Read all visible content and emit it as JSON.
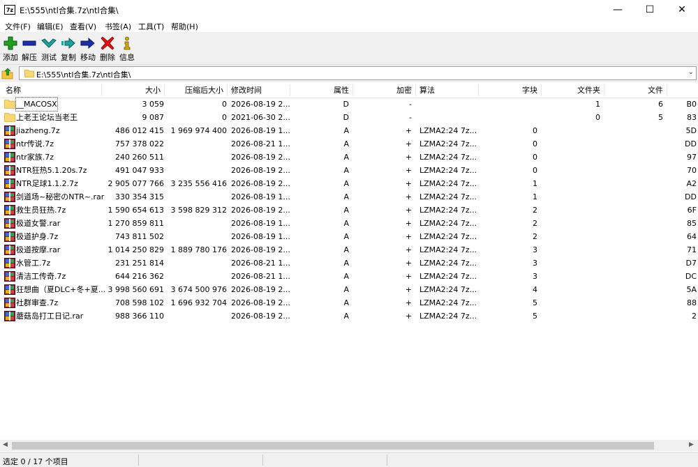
{
  "window": {
    "title": "E:\\555\\ntl合集.7z\\ntl合集\\",
    "app_icon_text": "7z",
    "controls": {
      "minimize": "—",
      "maximize": "☐",
      "close": "✕"
    }
  },
  "menu": [
    "文件(F)",
    "编辑(E)",
    "查看(V)",
    "书签(A)",
    "工具(T)",
    "帮助(H)"
  ],
  "toolbar": [
    {
      "label": "添加",
      "icon": "add-icon",
      "color": "#1fa01f"
    },
    {
      "label": "解压",
      "icon": "extract-icon",
      "color": "#1c2fa8"
    },
    {
      "label": "测试",
      "icon": "test-icon",
      "color": "#1aa3a3"
    },
    {
      "label": "复制",
      "icon": "copy-icon",
      "color": "#1aa3a3"
    },
    {
      "label": "移动",
      "icon": "move-icon",
      "color": "#1c2fa8"
    },
    {
      "label": "删除",
      "icon": "delete-icon",
      "color": "#e01010"
    },
    {
      "label": "信息",
      "icon": "info-icon",
      "color": "#d4a800"
    }
  ],
  "address": {
    "path": "E:\\555\\ntl合集.7z\\ntl合集\\"
  },
  "columns": [
    "名称",
    "大小",
    "压缩后大小",
    "修改时间",
    "属性",
    "加密",
    "算法",
    "字块",
    "文件夹",
    "文件",
    ""
  ],
  "files": [
    {
      "type": "folder",
      "name": "__MACOSX",
      "size": "3 059",
      "packed": "0",
      "modified": "2026-08-19 2...",
      "attr": "D",
      "enc": "-",
      "method": "",
      "block": "",
      "folders": "1",
      "files": "6",
      "crc": "B0"
    },
    {
      "type": "folder",
      "name": "上老王论坛当老王",
      "size": "9 087",
      "packed": "0",
      "modified": "2021-06-30 2...",
      "attr": "D",
      "enc": "-",
      "method": "",
      "block": "",
      "folders": "0",
      "files": "5",
      "crc": "83"
    },
    {
      "type": "archive",
      "name": "jiazheng.7z",
      "size": "486 012 415",
      "packed": "1 969 974 400",
      "modified": "2026-08-19 1...",
      "attr": "A",
      "enc": "+",
      "method": "LZMA2:24 7z...",
      "block": "0",
      "folders": "",
      "files": "",
      "crc": "5D"
    },
    {
      "type": "archive",
      "name": "ntr传说.7z",
      "size": "757 378 022",
      "packed": "",
      "modified": "2026-08-21 1...",
      "attr": "A",
      "enc": "+",
      "method": "LZMA2:24 7z...",
      "block": "0",
      "folders": "",
      "files": "",
      "crc": "DD"
    },
    {
      "type": "archive",
      "name": "ntr家族.7z",
      "size": "240 260 511",
      "packed": "",
      "modified": "2026-08-19 2...",
      "attr": "A",
      "enc": "+",
      "method": "LZMA2:24 7z...",
      "block": "0",
      "folders": "",
      "files": "",
      "crc": "97"
    },
    {
      "type": "archive",
      "name": "NTR狂热5.1.20s.7z",
      "size": "491 047 933",
      "packed": "",
      "modified": "2026-08-19 2...",
      "attr": "A",
      "enc": "+",
      "method": "LZMA2:24 7z...",
      "block": "0",
      "folders": "",
      "files": "",
      "crc": "70"
    },
    {
      "type": "archive",
      "name": "NTR足球1.1.2.7z",
      "size": "2 905 077 766",
      "packed": "3 235 556 416",
      "modified": "2026-08-19 2...",
      "attr": "A",
      "enc": "+",
      "method": "LZMA2:24 7z...",
      "block": "1",
      "folders": "",
      "files": "",
      "crc": "A2"
    },
    {
      "type": "archive",
      "name": "剑道场~秘密のNTR~.rar",
      "size": "330 354 315",
      "packed": "",
      "modified": "2026-08-19 1...",
      "attr": "A",
      "enc": "+",
      "method": "LZMA2:24 7z...",
      "block": "1",
      "folders": "",
      "files": "",
      "crc": "DD"
    },
    {
      "type": "archive",
      "name": "救生员狂热.7z",
      "size": "1 590 654 613",
      "packed": "3 598 829 312",
      "modified": "2026-08-19 2...",
      "attr": "A",
      "enc": "+",
      "method": "LZMA2:24 7z...",
      "block": "2",
      "folders": "",
      "files": "",
      "crc": "6F"
    },
    {
      "type": "archive",
      "name": "极道女警.rar",
      "size": "1 270 859 811",
      "packed": "",
      "modified": "2026-08-19 1...",
      "attr": "A",
      "enc": "+",
      "method": "LZMA2:24 7z...",
      "block": "2",
      "folders": "",
      "files": "",
      "crc": "85"
    },
    {
      "type": "archive",
      "name": "极道护身.7z",
      "size": "743 811 502",
      "packed": "",
      "modified": "2026-08-19 1...",
      "attr": "A",
      "enc": "+",
      "method": "LZMA2:24 7z...",
      "block": "2",
      "folders": "",
      "files": "",
      "crc": "64"
    },
    {
      "type": "archive",
      "name": "极道按摩.rar",
      "size": "1 014 250 829",
      "packed": "1 889 780 176",
      "modified": "2026-08-19 2...",
      "attr": "A",
      "enc": "+",
      "method": "LZMA2:24 7z...",
      "block": "3",
      "folders": "",
      "files": "",
      "crc": "71"
    },
    {
      "type": "archive",
      "name": "水管工.7z",
      "size": "231 251 814",
      "packed": "",
      "modified": "2026-08-21 1...",
      "attr": "A",
      "enc": "+",
      "method": "LZMA2:24 7z...",
      "block": "3",
      "folders": "",
      "files": "",
      "crc": "D7"
    },
    {
      "type": "archive",
      "name": "清洁工传奇.7z",
      "size": "644 216 362",
      "packed": "",
      "modified": "2026-08-21 1...",
      "attr": "A",
      "enc": "+",
      "method": "LZMA2:24 7z...",
      "block": "3",
      "folders": "",
      "files": "",
      "crc": "DC"
    },
    {
      "type": "archive",
      "name": "狂想曲（夏DLC+冬+夏...",
      "size": "3 998 560 691",
      "packed": "3 674 500 976",
      "modified": "2026-08-19 2...",
      "attr": "A",
      "enc": "+",
      "method": "LZMA2:24 7z...",
      "block": "4",
      "folders": "",
      "files": "",
      "crc": "5A"
    },
    {
      "type": "archive",
      "name": "社群审查.7z",
      "size": "708 598 102",
      "packed": "1 696 932 704",
      "modified": "2026-08-19 2...",
      "attr": "A",
      "enc": "+",
      "method": "LZMA2:24 7z...",
      "block": "5",
      "folders": "",
      "files": "",
      "crc": "88"
    },
    {
      "type": "archive",
      "name": "蘑菇岛打工日记.rar",
      "size": "988 366 110",
      "packed": "",
      "modified": "2026-08-19 2...",
      "attr": "A",
      "enc": "+",
      "method": "LZMA2:24 7z...",
      "block": "5",
      "folders": "",
      "files": "",
      "crc": "2"
    }
  ],
  "status": {
    "text": "选定 0 / 17 个项目"
  }
}
